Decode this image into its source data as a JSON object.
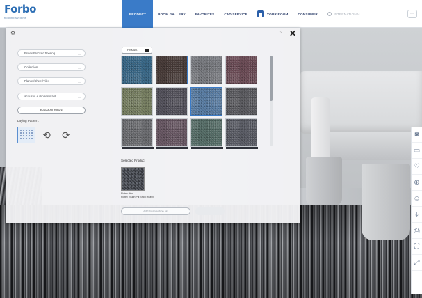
{
  "header": {
    "logo_text": "Forbo",
    "logo_tagline": "flooring systems",
    "nav": [
      {
        "label": "PRODUCT",
        "active": true
      },
      {
        "label": "ROOM GALLERY"
      },
      {
        "label": "FAVORITES"
      },
      {
        "label": "CAD SERVICE"
      },
      {
        "label": "YOUR ROOM",
        "icon": "house-icon"
      },
      {
        "label": "CONSUMER"
      },
      {
        "label": "INTERNATIONAL",
        "icon": "globe-icon",
        "muted": true
      }
    ],
    "more_label": "···"
  },
  "panel": {
    "gear_icon": "gear-icon",
    "close_label": "✕",
    "resize_label": "⇲",
    "filters": [
      "Flotex Flocked flooring",
      "Collection",
      "Planks/Sheet/Tiles",
      "acoustic + slip resistant"
    ],
    "reset_label": "Reset All Filters",
    "laying_pattern_label": "Laying Pattern:",
    "sort_label": "Product",
    "tiles": [
      {
        "color": "#3b6a8a"
      },
      {
        "color": "#4a3d3a"
      },
      {
        "color": "#7b7d82"
      },
      {
        "color": "#6e4e58"
      },
      {
        "color": "#7a8264"
      },
      {
        "color": "#56545e"
      },
      {
        "color": "#5b7fa6"
      },
      {
        "color": "#5e5e63"
      },
      {
        "color": "#6f7074"
      },
      {
        "color": "#6b5a66"
      },
      {
        "color": "#58706a"
      },
      {
        "color": "#5d5f68"
      }
    ],
    "selected_product_label": "Selected Product",
    "selected_code": "Flotex tiles",
    "selected_name": "Flotex Vision Pill Brain Heavy",
    "add_button_label": "Add to selection list"
  },
  "toolbar": [
    "camera-icon",
    "ruler-icon",
    "heart-icon",
    "zoom-in-icon",
    "person-icon",
    "download-icon",
    "print-icon",
    "fullscreen-icon",
    "expand-icon"
  ]
}
